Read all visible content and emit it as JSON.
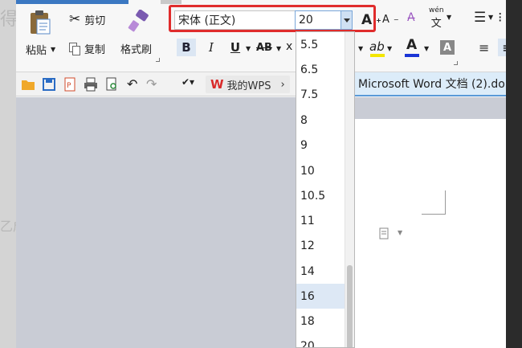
{
  "background": {
    "left_text_top": "得",
    "left_text_mid": "乙成"
  },
  "ribbon": {
    "paste_label": "粘贴",
    "cut_label": "剪切",
    "copy_label": "复制",
    "format_painter_label": "格式刷",
    "font_name": "宋体 (正文)",
    "font_size": "20",
    "bold": "B",
    "italic": "I",
    "underline": "U",
    "strike": "AB",
    "grow_font": "A",
    "shrink_font": "A",
    "pinyin": "文",
    "pinyin_top": "wén"
  },
  "quickbar": {
    "wps_label": "我的WPS"
  },
  "document_tab": {
    "title": "Microsoft Word 文档 (2).do"
  },
  "size_dropdown": {
    "items": [
      "5.5",
      "6.5",
      "7.5",
      "8",
      "9",
      "10",
      "10.5",
      "11",
      "12",
      "14",
      "16",
      "18",
      "20"
    ],
    "selected": "16"
  },
  "colors": {
    "highlight_border": "#e02c2c",
    "accent": "#3b78c2",
    "selected_item": "#dde8f5"
  }
}
